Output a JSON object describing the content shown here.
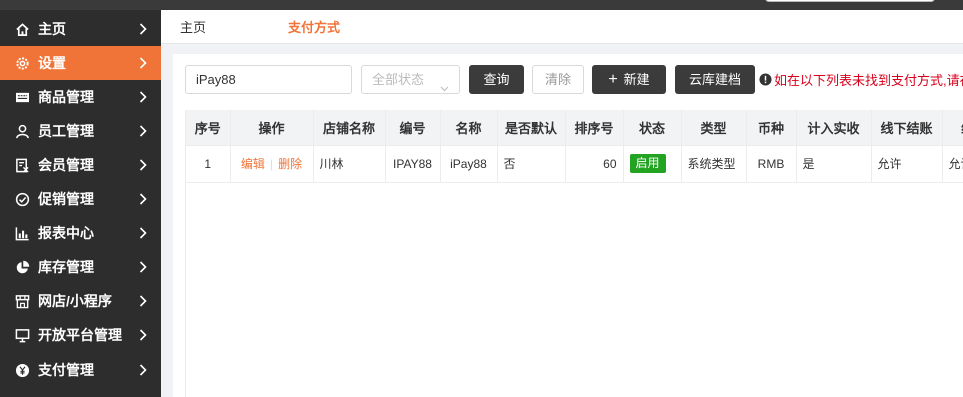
{
  "sidebar": {
    "items": [
      {
        "label": "主页",
        "icon": "home-icon"
      },
      {
        "label": "设置",
        "icon": "gear-icon",
        "active": true
      },
      {
        "label": "商品管理",
        "icon": "keyboard-icon"
      },
      {
        "label": "员工管理",
        "icon": "person-icon"
      },
      {
        "label": "会员管理",
        "icon": "member-card-icon"
      },
      {
        "label": "促销管理",
        "icon": "check-circle-icon"
      },
      {
        "label": "报表中心",
        "icon": "bar-chart-icon"
      },
      {
        "label": "库存管理",
        "icon": "pie-chart-icon"
      },
      {
        "label": "网店/小程序",
        "icon": "store-icon"
      },
      {
        "label": "开放平台管理",
        "icon": "monitor-icon"
      },
      {
        "label": "支付管理",
        "icon": "yuan-circle-icon"
      }
    ]
  },
  "tabs": {
    "home": "主页",
    "payment": "支付方式"
  },
  "toolbar": {
    "search_value": "iPay88",
    "status_placeholder": "全部状态",
    "query_label": "查询",
    "clear_label": "清除",
    "new_label": "新建",
    "cloud_label": "云库建档",
    "notice_text": "如在以下列表未找到支付方式,请在"
  },
  "table": {
    "headers": [
      "序号",
      "操作",
      "店铺名称",
      "编号",
      "名称",
      "是否默认",
      "排序号",
      "状态",
      "类型",
      "币种",
      "计入实收",
      "线下结账",
      "线下"
    ],
    "rows": [
      {
        "index": "1",
        "edit": "编辑",
        "delete": "删除",
        "shop": "川林",
        "code": "IPAY88",
        "name": "iPay88",
        "is_default": "否",
        "sort": "60",
        "status": "启用",
        "type": "系统类型",
        "currency": "RMB",
        "count_received": "是",
        "offline_checkout": "允许",
        "offline_more": "允许"
      }
    ]
  },
  "colors": {
    "accent": "#f07438",
    "sidebar_bg": "#2d2d2d",
    "status_green": "#22a322",
    "notice_red": "#d9001b"
  }
}
